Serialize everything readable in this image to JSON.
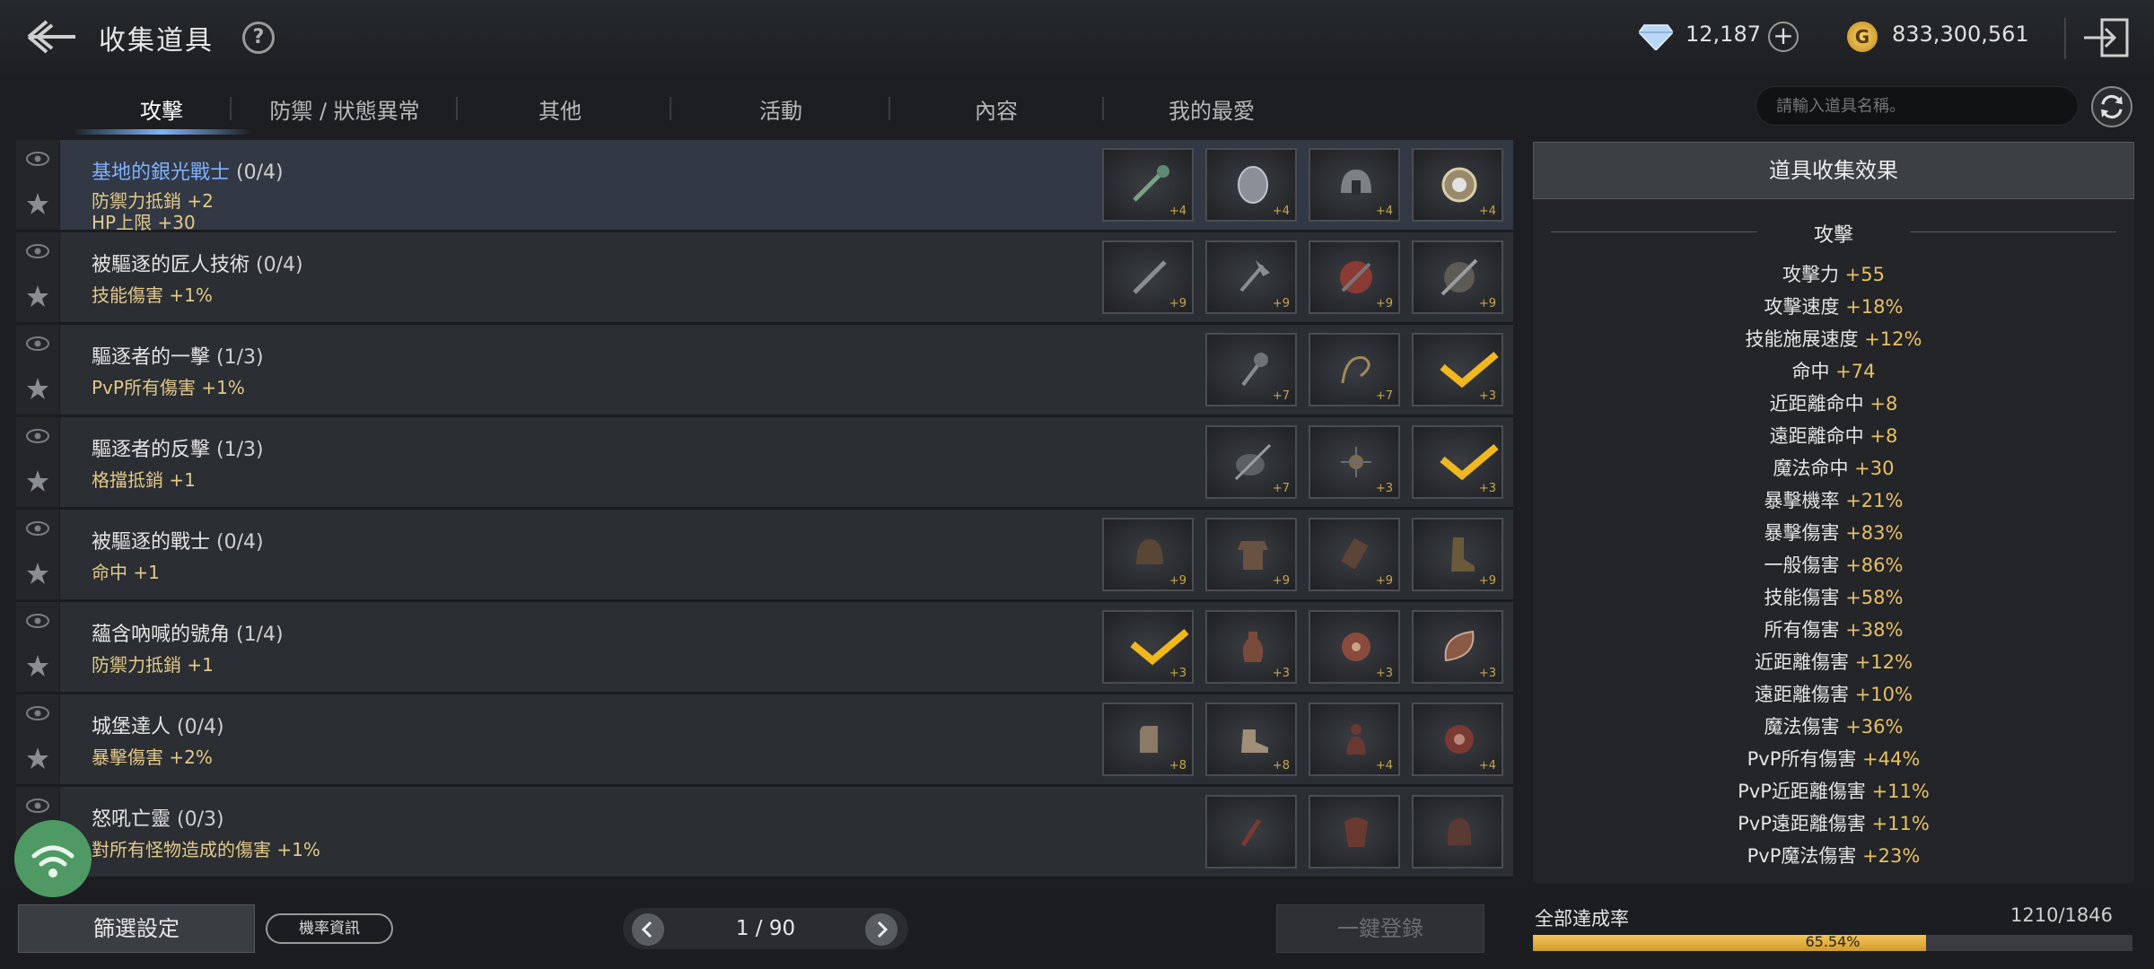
{
  "header": {
    "title": "收集道具",
    "help": "?",
    "diamonds": "12,187",
    "add": "+",
    "gold_symbol": "G",
    "gold": "833,300,561"
  },
  "tabs": [
    "攻擊",
    "防禦 / 狀態異常",
    "其他",
    "活動",
    "內容",
    "我的最愛"
  ],
  "search": {
    "placeholder": "請輸入道具名稱。"
  },
  "rows": [
    {
      "title": "基地的銀光戰士",
      "count": "(0/4)",
      "effects": [
        "防禦力抵銷 +2",
        "HP上限 +30"
      ],
      "slots": [
        "+4",
        "+4",
        "+4",
        "+4"
      ]
    },
    {
      "title": "被驅逐的匠人技術",
      "count": "(0/4)",
      "effects": [
        "技能傷害 +1%"
      ],
      "slots": [
        "+9",
        "+9",
        "+9",
        "+9"
      ]
    },
    {
      "title": "驅逐者的一擊",
      "count": "(1/3)",
      "effects": [
        "PvP所有傷害 +1%"
      ],
      "slots": [
        "+7",
        "+7",
        "+3"
      ]
    },
    {
      "title": "驅逐者的反擊",
      "count": "(1/3)",
      "effects": [
        "格擋抵銷 +1"
      ],
      "slots": [
        "+7",
        "+3",
        "+3"
      ]
    },
    {
      "title": "被驅逐的戰士",
      "count": "(0/4)",
      "effects": [
        "命中 +1"
      ],
      "slots": [
        "+9",
        "+9",
        "+9",
        "+9"
      ]
    },
    {
      "title": "蘊含吶喊的號角",
      "count": "(1/4)",
      "effects": [
        "防禦力抵銷 +1"
      ],
      "slots": [
        "+3",
        "+3",
        "+3",
        "+3"
      ]
    },
    {
      "title": "城堡達人",
      "count": "(0/4)",
      "effects": [
        "暴擊傷害 +2%"
      ],
      "slots": [
        "+8",
        "+8",
        "+4",
        "+4"
      ]
    },
    {
      "title": "怒吼亡靈",
      "count": "(0/3)",
      "effects": [
        "對所有怪物造成的傷害 +1%"
      ],
      "slots": [
        "",
        "",
        ""
      ]
    }
  ],
  "effects": {
    "header": "道具收集效果",
    "section": "攻擊",
    "stats": [
      {
        "name": "攻擊力",
        "value": "+55"
      },
      {
        "name": "攻擊速度",
        "value": "+18%"
      },
      {
        "name": "技能施展速度",
        "value": "+12%"
      },
      {
        "name": "命中",
        "value": "+74"
      },
      {
        "name": "近距離命中",
        "value": "+8"
      },
      {
        "name": "遠距離命中",
        "value": "+8"
      },
      {
        "name": "魔法命中",
        "value": "+30"
      },
      {
        "name": "暴擊機率",
        "value": "+21%"
      },
      {
        "name": "暴擊傷害",
        "value": "+83%"
      },
      {
        "name": "一般傷害",
        "value": "+86%"
      },
      {
        "name": "技能傷害",
        "value": "+58%"
      },
      {
        "name": "所有傷害",
        "value": "+38%"
      },
      {
        "name": "近距離傷害",
        "value": "+12%"
      },
      {
        "name": "遠距離傷害",
        "value": "+10%"
      },
      {
        "name": "魔法傷害",
        "value": "+36%"
      },
      {
        "name": "PvP所有傷害",
        "value": "+44%"
      },
      {
        "name": "PvP近距離傷害",
        "value": "+11%"
      },
      {
        "name": "PvP遠距離傷害",
        "value": "+11%"
      },
      {
        "name": "PvP魔法傷害",
        "value": "+23%"
      }
    ]
  },
  "footer": {
    "filter": "篩選設定",
    "prob": "機率資訊",
    "page": "1 / 90",
    "onekey": "一鍵登錄",
    "rate_label": "全部達成率",
    "rate_count": "1210/1846",
    "rate_pct": "65.54%",
    "rate_value": 65.54
  },
  "colors": {
    "accent_gold": "#e8c066",
    "link_blue": "#7fb0ff"
  }
}
